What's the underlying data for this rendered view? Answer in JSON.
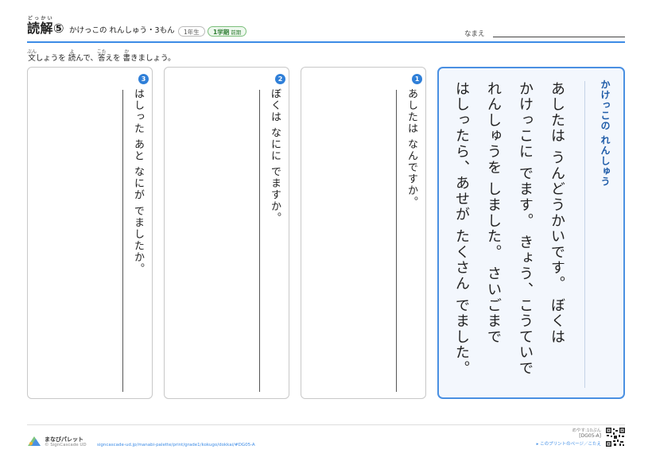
{
  "header": {
    "title_main": "読解",
    "title_ruby": "どっかい",
    "title_num": "⑤",
    "subtitle": "かけっこの れんしゅう・3もん",
    "grade": "1年生",
    "term": "1学期",
    "term_small": "前期",
    "name_label": "なまえ"
  },
  "instruction": {
    "p1_base": "文",
    "p1_ruby": "ぶん",
    "p2": "しょうを ",
    "p3_base": "読",
    "p3_ruby": "よ",
    "p4": "んで、",
    "p5_base": "答",
    "p5_ruby": "こた",
    "p6": "えを ",
    "p7_base": "書",
    "p7_ruby": "か",
    "p8": "きましょう。"
  },
  "questions": [
    {
      "num": "1",
      "text": "あしたは なんですか。"
    },
    {
      "num": "2",
      "text": "ぼくは なにに でますか。"
    },
    {
      "num": "3",
      "text": "はしった あと なにが でましたか。"
    }
  ],
  "story": {
    "title": "かけっこの れんしゅう",
    "lines": [
      "あしたは うんどうかいです。 ぼくは",
      "かけっこに でます。 きょう、こうていで",
      "れんしゅうを しました。 さいごまで",
      "はしったら、あせが たくさん でました。"
    ]
  },
  "footer": {
    "logo": "まなびパレット",
    "copyright": "© SignCascade UD",
    "url": "signcascade-ud.jp/manabi-palette/print/grade1/kokugo/dokkai/#DG05-A",
    "time": "めやす:10ぷん",
    "code": "[DG05-A]",
    "answer_link": "▸ このプリントのページ／こたえ"
  },
  "colors": {
    "accent": "#3d8ce6",
    "number_badge": "#2f7fd8",
    "story_border": "#4a90e2",
    "story_title": "#1f5ca8"
  }
}
